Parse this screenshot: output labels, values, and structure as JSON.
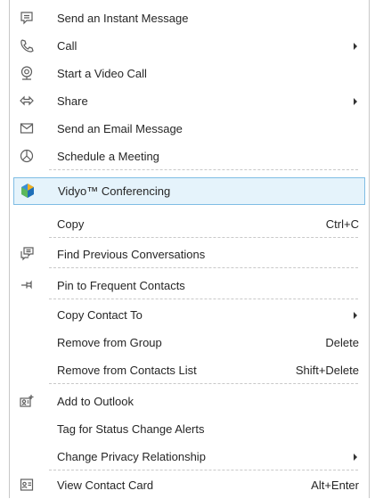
{
  "menu": {
    "items": [
      {
        "label": "Send an Instant Message",
        "icon": "chat-bubble-icon"
      },
      {
        "label": "Call",
        "icon": "phone-icon",
        "submenu": true
      },
      {
        "label": "Start a Video Call",
        "icon": "webcam-icon"
      },
      {
        "label": "Share",
        "icon": "share-arrows-icon",
        "submenu": true
      },
      {
        "label": "Send an Email Message",
        "icon": "envelope-icon"
      },
      {
        "label": "Schedule a Meeting",
        "icon": "meeting-icon"
      },
      {
        "label": "Vidyo™ Conferencing",
        "icon": "vidyo-logo-icon",
        "highlighted": true
      },
      {
        "label": "Copy",
        "shortcut": "Ctrl+C"
      },
      {
        "label": "Find Previous Conversations",
        "icon": "conversation-history-icon"
      },
      {
        "label": "Pin to Frequent Contacts",
        "icon": "pin-icon"
      },
      {
        "label": "Copy Contact To",
        "submenu": true
      },
      {
        "label": "Remove from Group",
        "shortcut": "Delete"
      },
      {
        "label": "Remove from Contacts List",
        "shortcut": "Shift+Delete"
      },
      {
        "label": "Add to Outlook",
        "icon": "add-contact-icon"
      },
      {
        "label": "Tag for Status Change Alerts"
      },
      {
        "label": "Change Privacy Relationship",
        "submenu": true
      },
      {
        "label": "View Contact Card",
        "icon": "contact-card-icon",
        "shortcut": "Alt+Enter"
      }
    ]
  },
  "colors": {
    "highlight_bg": "#e5f3fb",
    "highlight_border": "#7fbde4",
    "text": "#262626",
    "icon": "#5d5d5d"
  }
}
